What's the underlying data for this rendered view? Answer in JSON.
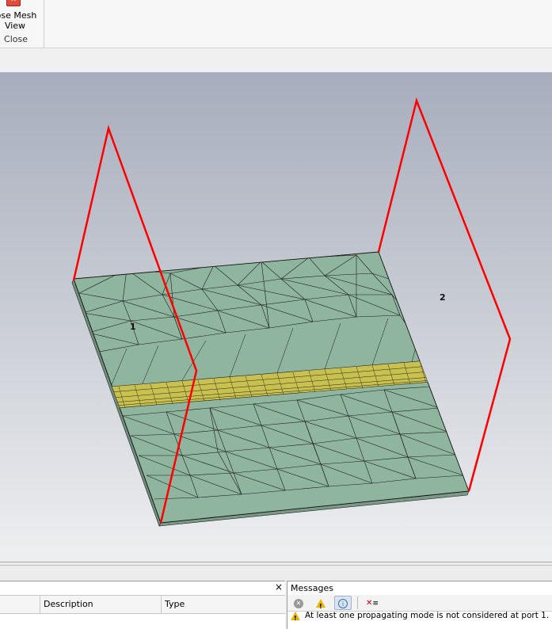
{
  "ribbon": {
    "close_mesh_label": "lose Mesh View",
    "close_mesh_line1": "lose Mesh",
    "close_mesh_line2": "View",
    "group_label": "Close"
  },
  "viewport": {
    "port_1_label": "1",
    "port_2_label": "2",
    "colors": {
      "substrate": "#8fb59f",
      "port_frame": "#ff0000",
      "strip_mesh": "#d8d44a"
    }
  },
  "results_panel": {
    "close_glyph": "×",
    "columns": [
      "",
      "Description",
      "Type"
    ]
  },
  "messages_panel": {
    "title": "Messages",
    "toolbar": {
      "errors_icon": "error-filter-icon",
      "warnings_icon": "warning-filter-icon",
      "info_icon": "info-filter-icon",
      "clear_icon": "clear-messages-icon"
    },
    "rows": [
      {
        "icon": "warning-icon",
        "text": "At least one propagating mode is not considered at port 1."
      }
    ]
  }
}
